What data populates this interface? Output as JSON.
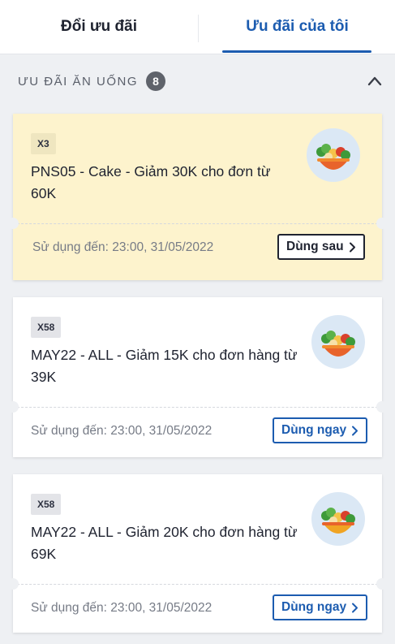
{
  "tabs": [
    {
      "label": "Đổi ưu đãi",
      "active": false
    },
    {
      "label": "Ưu đãi của tôi",
      "active": true
    }
  ],
  "section": {
    "title": "ƯU ĐÃI ĂN UỐNG",
    "count": "8"
  },
  "vouchers": [
    {
      "tag": "X3",
      "title": "PNS05 - Cake - Giảm 30K cho đơn từ 60K",
      "expiry": "Sử dụng đến: 23:00, 31/05/2022",
      "button": "Dùng sau",
      "highlighted": true
    },
    {
      "tag": "X58",
      "title": "MAY22 - ALL - Giảm 15K cho đơn hàng từ 39K",
      "expiry": "Sử dụng đến: 23:00, 31/05/2022",
      "button": "Dùng ngay",
      "highlighted": false
    },
    {
      "tag": "X58",
      "title": "MAY22 - ALL - Giảm 20K cho đơn hàng từ 69K",
      "expiry": "Sử dụng đến: 23:00, 31/05/2022",
      "button": "Dùng ngay",
      "highlighted": false
    }
  ],
  "colors": {
    "accent": "#1c5cb0",
    "highlight_bg": "#fdf3cd",
    "text": "#1f2330",
    "muted": "#767b86"
  },
  "icons": {
    "collapse": "chevron-up-icon",
    "button_arrow": "chevron-right-icon",
    "thumbnail": "food-bowl-icon"
  }
}
